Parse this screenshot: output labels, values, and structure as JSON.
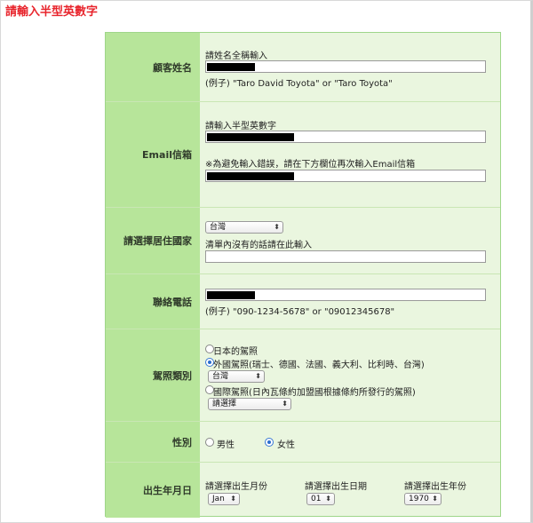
{
  "page_title": "請輸入半型英數字",
  "customer_name": {
    "label": "顧客姓名",
    "hint": "請姓名全稱輸入",
    "example": "(例子) \"Taro David Toyota\" or \"Taro Toyota\""
  },
  "email": {
    "label": "Email信箱",
    "hint": "請輸入半型英數字",
    "confirm_note": "※為避免輸入錯誤，請在下方欄位再次輸入Email信箱"
  },
  "country": {
    "label": "請選擇居住國家",
    "selected": "台灣",
    "other_hint": "清單內沒有的話請在此輸入"
  },
  "phone": {
    "label": "聯絡電話",
    "example": "(例子) \"090-1234-5678\" or \"09012345678\""
  },
  "license": {
    "label": "駕照類別",
    "option_japan": "日本的駕照",
    "option_foreign": "外國駕照(瑞士、德國、法國、義大利、比利時、台灣)",
    "foreign_country_selected": "台灣",
    "option_international": "國際駕照(日內瓦條約加盟國根據條約所發行的駕照)",
    "international_selected": "請選擇",
    "selected_option": "foreign"
  },
  "gender": {
    "label": "性別",
    "male": "男性",
    "female": "女性",
    "selected": "female"
  },
  "birth": {
    "label": "出生年月日",
    "month_label": "請選擇出生月份",
    "month_value": "Jan",
    "day_label": "請選擇出生日期",
    "day_value": "01",
    "year_label": "請選擇出生年份",
    "year_value": "1970"
  }
}
